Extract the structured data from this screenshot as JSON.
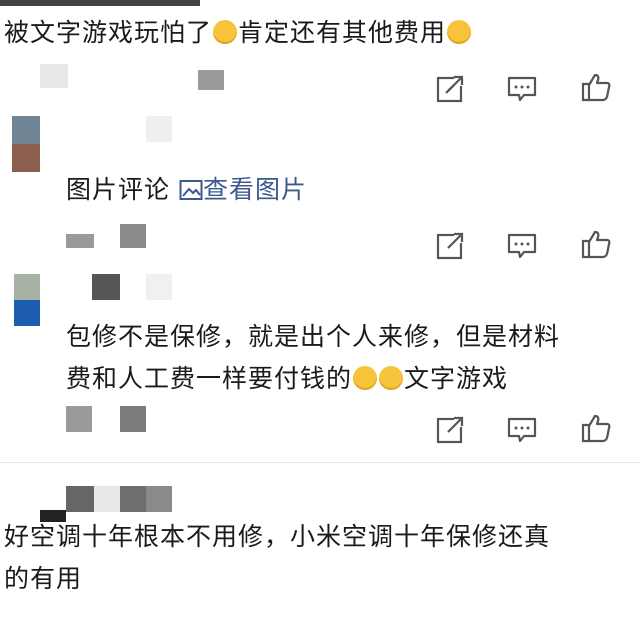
{
  "comments": [
    {
      "text_parts": {
        "a": "被文字游戏玩怕了",
        "b": "肯定还有其他费用"
      },
      "emoji_after_a": "cry-laugh-emoji",
      "emoji_after_b": "smile-emoji"
    },
    {
      "label": "图片评论",
      "link_icon": "image-icon",
      "link_label": "查看图片"
    },
    {
      "line1": "包修不是保修，就是出个人来修，但是材料",
      "line2_a": "费和人工费一样要付钱的",
      "line2_b": "文字游戏"
    },
    {
      "line1": "好空调十年根本不用修，小米空调十年保修还真",
      "line2": "的有用"
    }
  ],
  "actions": {
    "share_icon": "share-icon",
    "comment_icon": "comment-icon",
    "like_icon": "thumbs-up-icon"
  },
  "colors": {
    "text": "#1a1a1a",
    "link": "#3c5a8c",
    "icon": "#555555"
  }
}
